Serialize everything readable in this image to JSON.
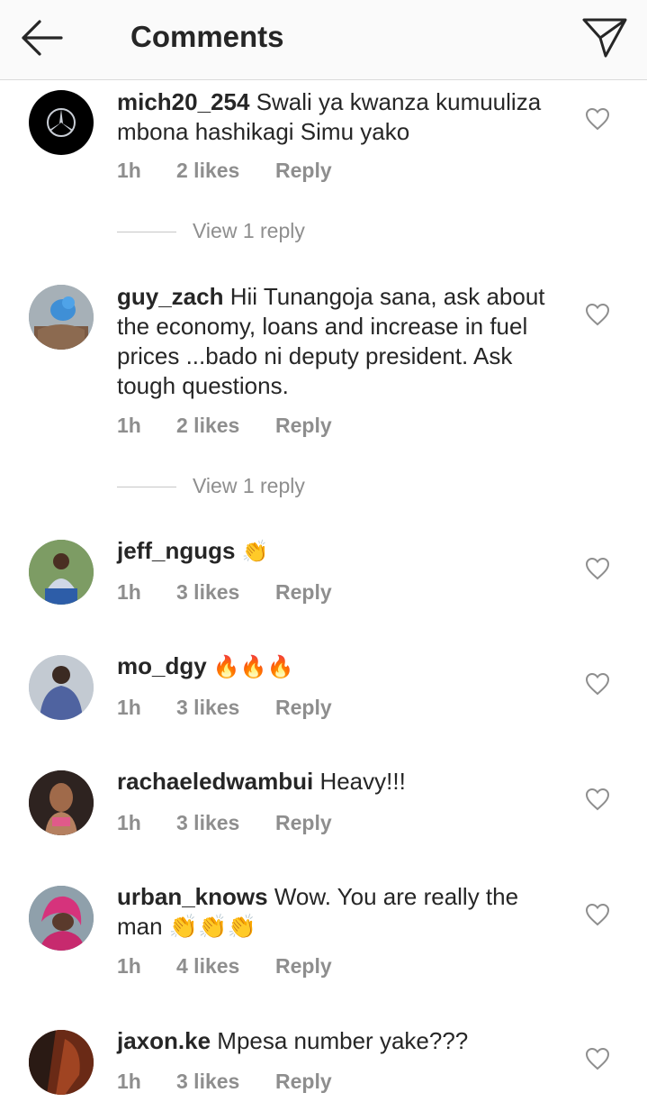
{
  "header": {
    "title": "Comments"
  },
  "comments": [
    {
      "username": "mich20_254",
      "text": "Swali ya kwanza kumuuliza mbona hashikagi Simu yako",
      "time": "1h",
      "likes": "2 likes",
      "reply": "Reply",
      "view_replies": "View 1 reply"
    },
    {
      "username": "guy_zach",
      "text": "Hii Tunangoja sana, ask about the economy, loans  and increase in fuel prices ...bado ni deputy president. Ask tough questions.",
      "time": "1h",
      "likes": "2 likes",
      "reply": "Reply",
      "view_replies": "View 1 reply"
    },
    {
      "username": "jeff_ngugs",
      "text": "👏",
      "time": "1h",
      "likes": "3 likes",
      "reply": "Reply"
    },
    {
      "username": "mo_dgy",
      "text": "🔥🔥🔥",
      "time": "1h",
      "likes": "3 likes",
      "reply": "Reply"
    },
    {
      "username": "rachaeledwambui",
      "text": "Heavy!!!",
      "time": "1h",
      "likes": "3 likes",
      "reply": "Reply"
    },
    {
      "username": "urban_knows",
      "text": "Wow. You are really the man 👏👏👏",
      "time": "1h",
      "likes": "4 likes",
      "reply": "Reply"
    },
    {
      "username": "jaxon.ke",
      "text": "Mpesa number yake???",
      "time": "1h",
      "likes": "3 likes",
      "reply": "Reply"
    }
  ],
  "colors": {
    "text": "#262626",
    "secondary": "#8e8e8e",
    "header_bg": "#fafafa"
  },
  "icons": {
    "back": "arrow-left-icon",
    "send": "paper-plane-icon",
    "like": "heart-outline-icon"
  }
}
